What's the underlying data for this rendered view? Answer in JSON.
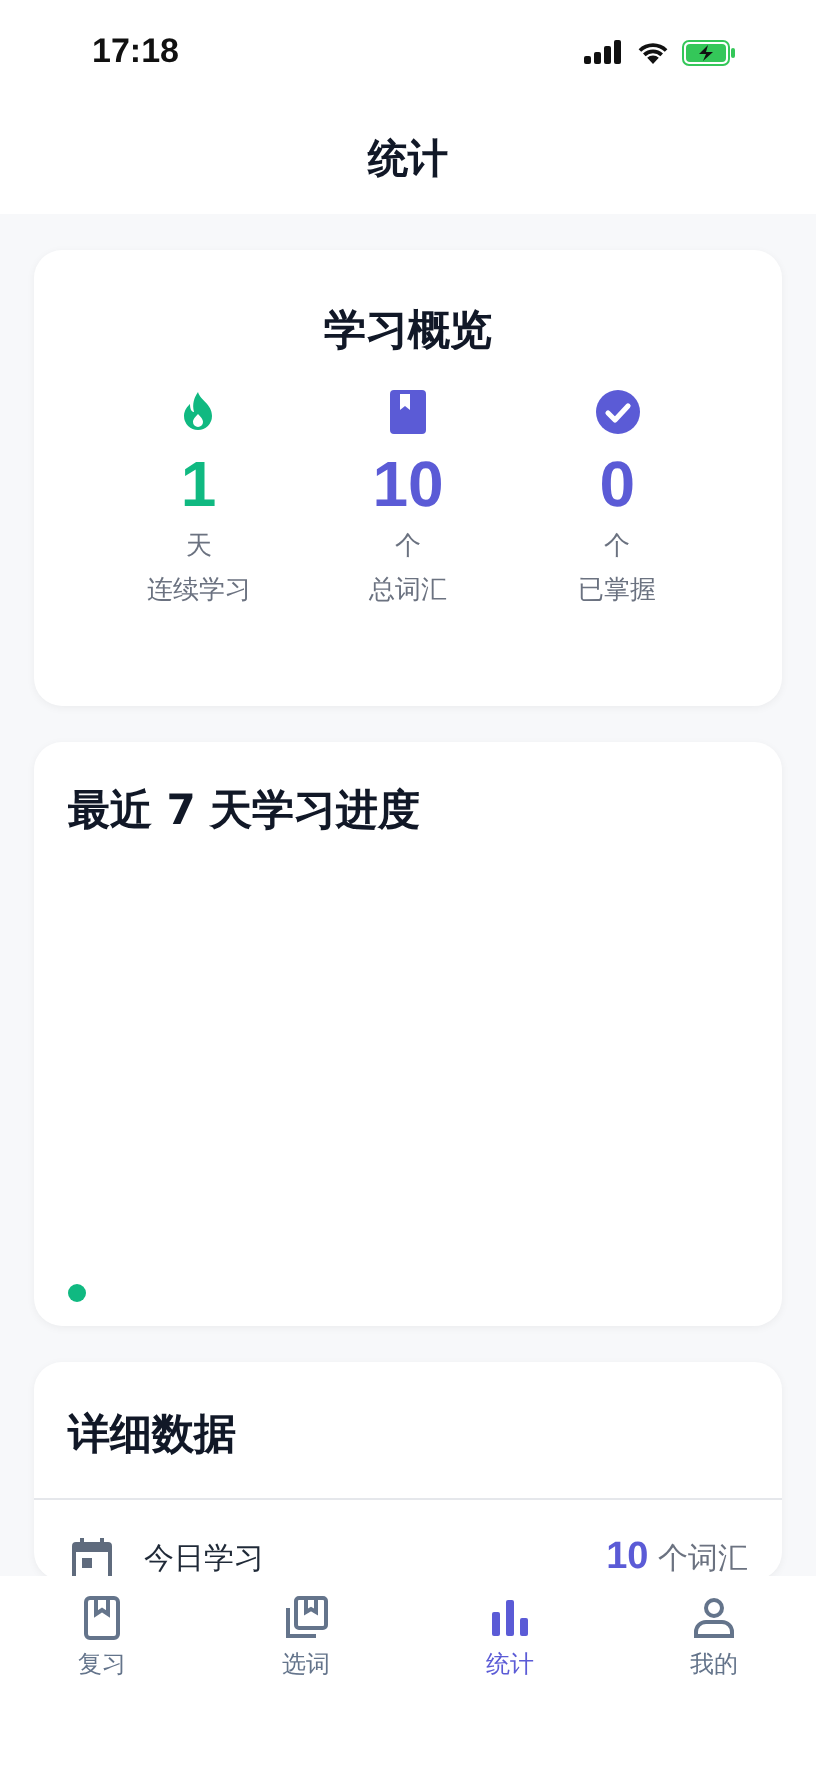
{
  "status_bar": {
    "time": "17:18"
  },
  "header": {
    "title": "统计"
  },
  "overview": {
    "title": "学习概览",
    "stats": [
      {
        "kind": "flame",
        "color": "#10b981",
        "value": "1",
        "unit": "天",
        "label": "连续学习"
      },
      {
        "kind": "book",
        "color": "#5b5bd6",
        "value": "10",
        "unit": "个",
        "label": "总词汇"
      },
      {
        "kind": "check",
        "color": "#5b5bd6",
        "value": "0",
        "unit": "个",
        "label": "已掌握"
      }
    ]
  },
  "progress": {
    "title": "最近 7 天学习进度"
  },
  "details": {
    "title": "详细数据",
    "rows": [
      {
        "kind": "calendar",
        "label": "今日学习",
        "value": "10",
        "unit": "个词汇"
      }
    ]
  },
  "tabs": [
    {
      "kind": "book",
      "label": "复习",
      "selected": false
    },
    {
      "kind": "books",
      "label": "选词",
      "selected": false
    },
    {
      "kind": "chart",
      "label": "统计",
      "selected": true
    },
    {
      "kind": "person",
      "label": "我的",
      "selected": false
    }
  ]
}
